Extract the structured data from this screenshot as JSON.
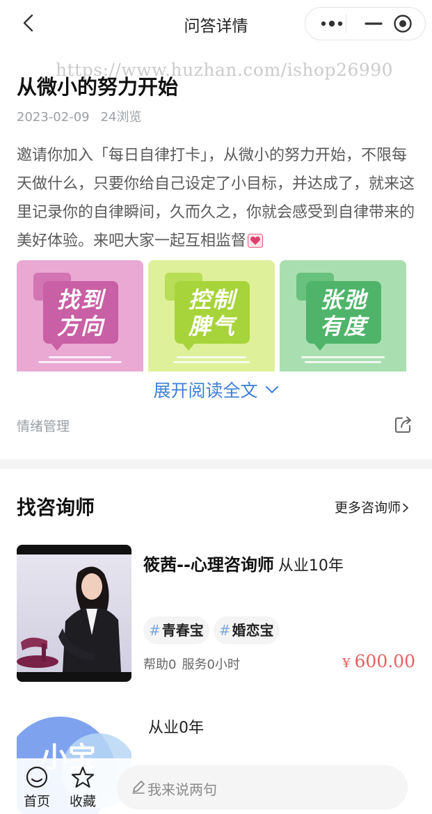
{
  "nav": {
    "title": "问答详情",
    "back_icon": "chevron-left-icon",
    "capsule_icons": [
      "more-dots-icon",
      "minimize-icon",
      "close-circle-icon"
    ]
  },
  "watermark": "https://www.huzhan.com/ishop26990",
  "post": {
    "title": "从微小的努力开始",
    "date": "2023-02-09",
    "views": "24浏览",
    "body": "邀请你加入「每日自律打卡」，从微小的努力开始，不限每天做什么，只要你给自己设定了小目标，并达成了，就来这里记录你的自律瞬间，久而久之，你就会感受到自律带来的美好体验。来吧大家一起互相监督",
    "emoji": "heart-icon",
    "images": [
      {
        "text_line1": "找到",
        "text_line2": "方向",
        "bg": "#e9a9d3",
        "bubble": "#c95fa4"
      },
      {
        "text_line1": "控制",
        "text_line2": "脾气",
        "bg": "#dff09a",
        "bubble": "#a7d43a"
      },
      {
        "text_line1": "张弛",
        "text_line2": "有度",
        "bg": "#a9dfb0",
        "bubble": "#4fb46a"
      }
    ],
    "expand_label": "展开阅读全文",
    "category": "情绪管理",
    "share_icon": "share-icon"
  },
  "counselors_section": {
    "title": "找咨询师",
    "more_label": "更多咨询师",
    "items": [
      {
        "name": "筱茜--心理咨询师",
        "years": "从业10年",
        "tags": [
          "青春宝",
          "婚恋宝"
        ],
        "help": "帮助0",
        "service": "服务0小时",
        "price_symbol": "¥",
        "price": "600.00"
      },
      {
        "name": "",
        "years": "从业0年",
        "avatar_text": "小宝"
      }
    ]
  },
  "bottom_bar": {
    "home_label": "首页",
    "fav_label": "收藏",
    "comment_placeholder": "我来说两句"
  },
  "colors": {
    "link_blue": "#3d7fd8",
    "price_red": "#e85f5f",
    "muted_gray": "#9aa0a6"
  }
}
